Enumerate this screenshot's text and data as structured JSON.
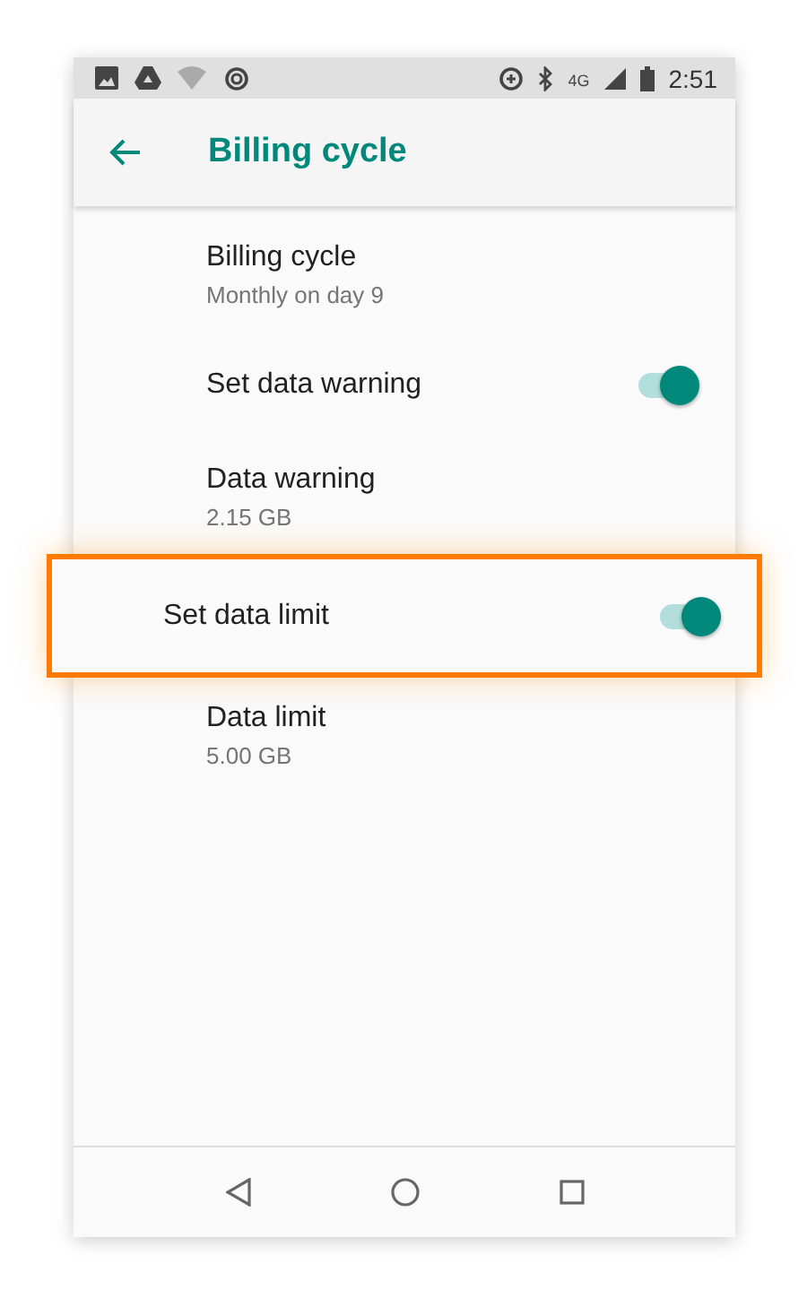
{
  "status_bar": {
    "network": "4G",
    "time": "2:51"
  },
  "app_bar": {
    "title": "Billing cycle"
  },
  "items": [
    {
      "kind": "text",
      "title": "Billing cycle",
      "summary": "Monthly on day 9"
    },
    {
      "kind": "switch",
      "title": "Set data warning",
      "on": true,
      "highlighted": false
    },
    {
      "kind": "text",
      "title": "Data warning",
      "summary": "2.15 GB"
    },
    {
      "kind": "switch",
      "title": "Set data limit",
      "on": true,
      "highlighted": true
    },
    {
      "kind": "text",
      "title": "Data limit",
      "summary": "5.00 GB"
    }
  ]
}
